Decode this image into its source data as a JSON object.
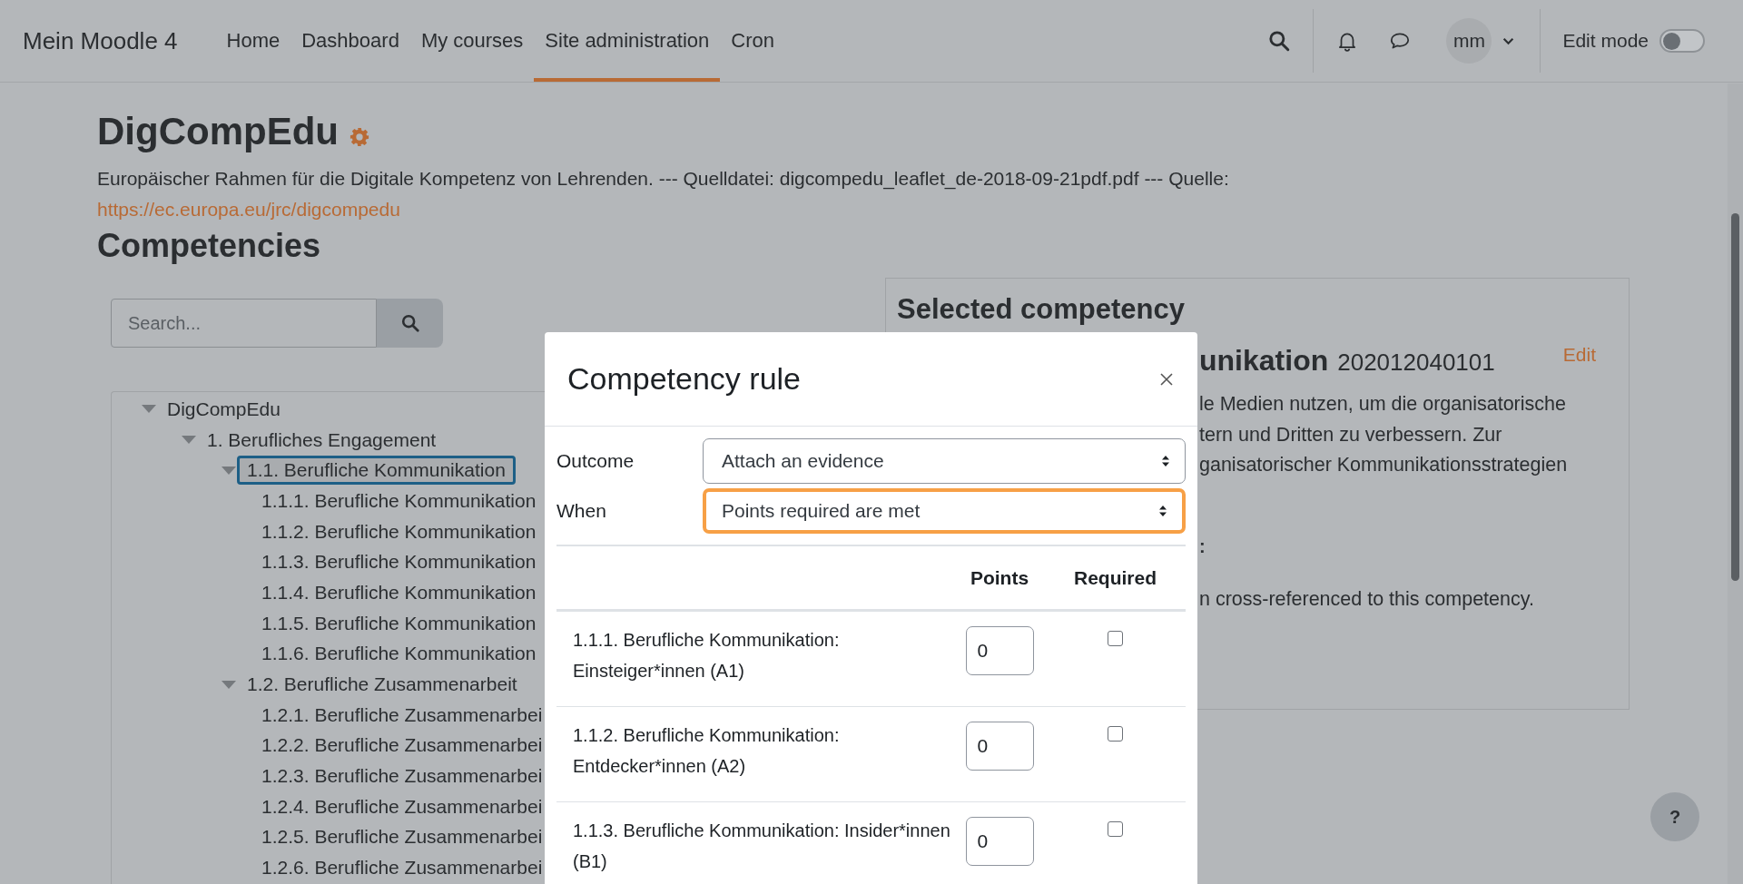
{
  "navbar": {
    "brand": "Mein Moodle 4",
    "links": [
      {
        "label": "Home",
        "selected": false
      },
      {
        "label": "Dashboard",
        "selected": false
      },
      {
        "label": "My courses",
        "selected": false
      },
      {
        "label": "Site administration",
        "selected": true
      },
      {
        "label": "Cron",
        "selected": false
      }
    ],
    "avatar": "mm",
    "edit_mode": {
      "label": "Edit mode",
      "on": false
    }
  },
  "page": {
    "title": "DigCompEdu",
    "description": "Europäischer Rahmen für die Digitale Kompetenz von Lehrenden. --- Quelldatei: digcompedu_leaflet_de-2018-09-21pdf.pdf --- Quelle:",
    "link": "https://ec.europa.eu/jrc/digcompedu",
    "section_title": "Competencies"
  },
  "search": {
    "placeholder": "Search..."
  },
  "tree": [
    {
      "label": "DigCompEdu",
      "expanded": true,
      "selected": false,
      "children": [
        {
          "label": "1. Berufliches Engagement",
          "expanded": true,
          "selected": false,
          "children": [
            {
              "label": "1.1. Berufliche Kommunikation",
              "expanded": true,
              "selected": true,
              "children": [
                {
                  "label": "1.1.1. Berufliche Kommunikation",
                  "selected": false
                },
                {
                  "label": "1.1.2. Berufliche Kommunikation",
                  "selected": false
                },
                {
                  "label": "1.1.3. Berufliche Kommunikation",
                  "selected": false
                },
                {
                  "label": "1.1.4. Berufliche Kommunikation",
                  "selected": false
                },
                {
                  "label": "1.1.5. Berufliche Kommunikation",
                  "selected": false
                },
                {
                  "label": "1.1.6. Berufliche Kommunikation",
                  "selected": false
                }
              ]
            },
            {
              "label": "1.2. Berufliche Zusammenarbeit",
              "expanded": true,
              "selected": false,
              "children": [
                {
                  "label": "1.2.1. Berufliche Zusammenarbei",
                  "selected": false
                },
                {
                  "label": "1.2.2. Berufliche Zusammenarbei",
                  "selected": false
                },
                {
                  "label": "1.2.3. Berufliche Zusammenarbei",
                  "selected": false
                },
                {
                  "label": "1.2.4. Berufliche Zusammenarbei",
                  "selected": false
                },
                {
                  "label": "1.2.5. Berufliche Zusammenarbei",
                  "selected": false
                },
                {
                  "label": "1.2.6. Berufliche Zusammenarbei",
                  "selected": false
                }
              ]
            }
          ]
        }
      ]
    }
  ],
  "selected_competency": {
    "title": "Selected competency",
    "name": "unikation",
    "idnumber": "202012040101",
    "edit": "Edit",
    "description_lines": [
      "le Medien nutzen, um die organisatorische",
      "tern und Dritten zu verbessern. Zur",
      "ganisatorischer Kommunikationsstrategien"
    ],
    "label_fragment": ":",
    "note": "n cross-referenced to this competency."
  },
  "modal": {
    "title": "Competency rule",
    "fields": [
      {
        "label": "Outcome",
        "value": "Attach an evidence",
        "focused": false
      },
      {
        "label": "When",
        "value": "Points required are met",
        "focused": true
      }
    ],
    "columns": [
      "Points",
      "Required"
    ],
    "rows": [
      {
        "name": "1.1.1. Berufliche Kommunikation: Einsteiger*innen (A1)",
        "points": "0",
        "required": false
      },
      {
        "name": "1.1.2. Berufliche Kommunikation: Entdecker*innen (A2)",
        "points": "0",
        "required": false
      },
      {
        "name": "1.1.3. Berufliche Kommunikation: Insider*innen (B1)",
        "points": "0",
        "required": false
      }
    ]
  },
  "help": "?"
}
